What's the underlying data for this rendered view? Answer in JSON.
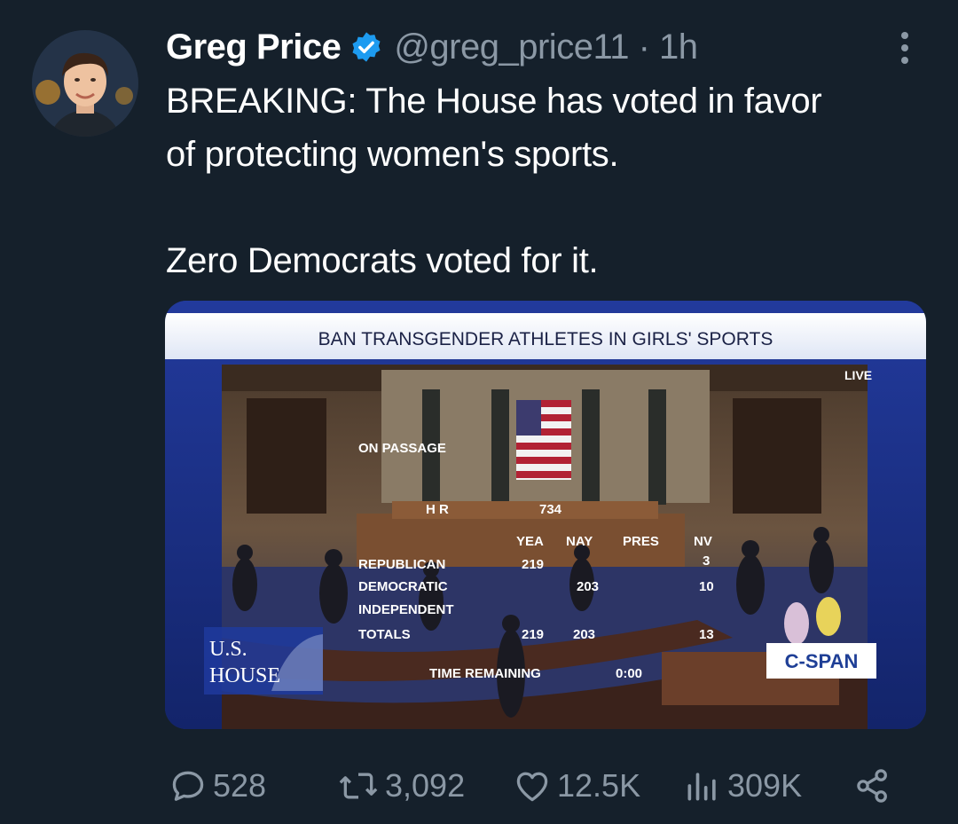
{
  "tweet": {
    "author_name": "Greg Price",
    "handle_time": "@greg_price11 · 1h",
    "text_lines": [
      "BREAKING: The House has voted in favor",
      "of protecting women's sports.",
      "Zero Democrats voted for it."
    ]
  },
  "media": {
    "banner": "BAN TRANSGENDER ATHLETES IN GIRLS' SPORTS",
    "live_label": "LIVE",
    "on_passage": "ON PASSAGE",
    "bill_prefix": "H R",
    "bill_number": "734",
    "columns": [
      "YEA",
      "NAY",
      "PRES",
      "NV"
    ],
    "rows": [
      {
        "party": "REPUBLICAN",
        "yea": "219",
        "nay": "",
        "pres": "",
        "nv": "3"
      },
      {
        "party": "DEMOCRATIC",
        "yea": "",
        "nay": "203",
        "pres": "",
        "nv": "10"
      },
      {
        "party": "INDEPENDENT",
        "yea": "",
        "nay": "",
        "pres": "",
        "nv": ""
      },
      {
        "party": "TOTALS",
        "yea": "219",
        "nay": "203",
        "pres": "",
        "nv": "13"
      }
    ],
    "time_label": "TIME REMAINING",
    "time_value": "0:00",
    "house_logo": [
      "U.S.",
      "HOUSE"
    ],
    "network_logo": "C-SPAN"
  },
  "actions": {
    "replies": "528",
    "reposts": "3,092",
    "likes": "12.5K",
    "views": "309K"
  },
  "colors": {
    "background": "#15202b",
    "secondary_text": "#8b98a5",
    "verified_badge": "#1d9bf0",
    "media_frame_blue": "#1c2f8a"
  },
  "icons": [
    "verified-badge-icon",
    "more-options-icon",
    "reply-icon",
    "repost-icon",
    "like-icon",
    "views-icon",
    "share-icon"
  ]
}
